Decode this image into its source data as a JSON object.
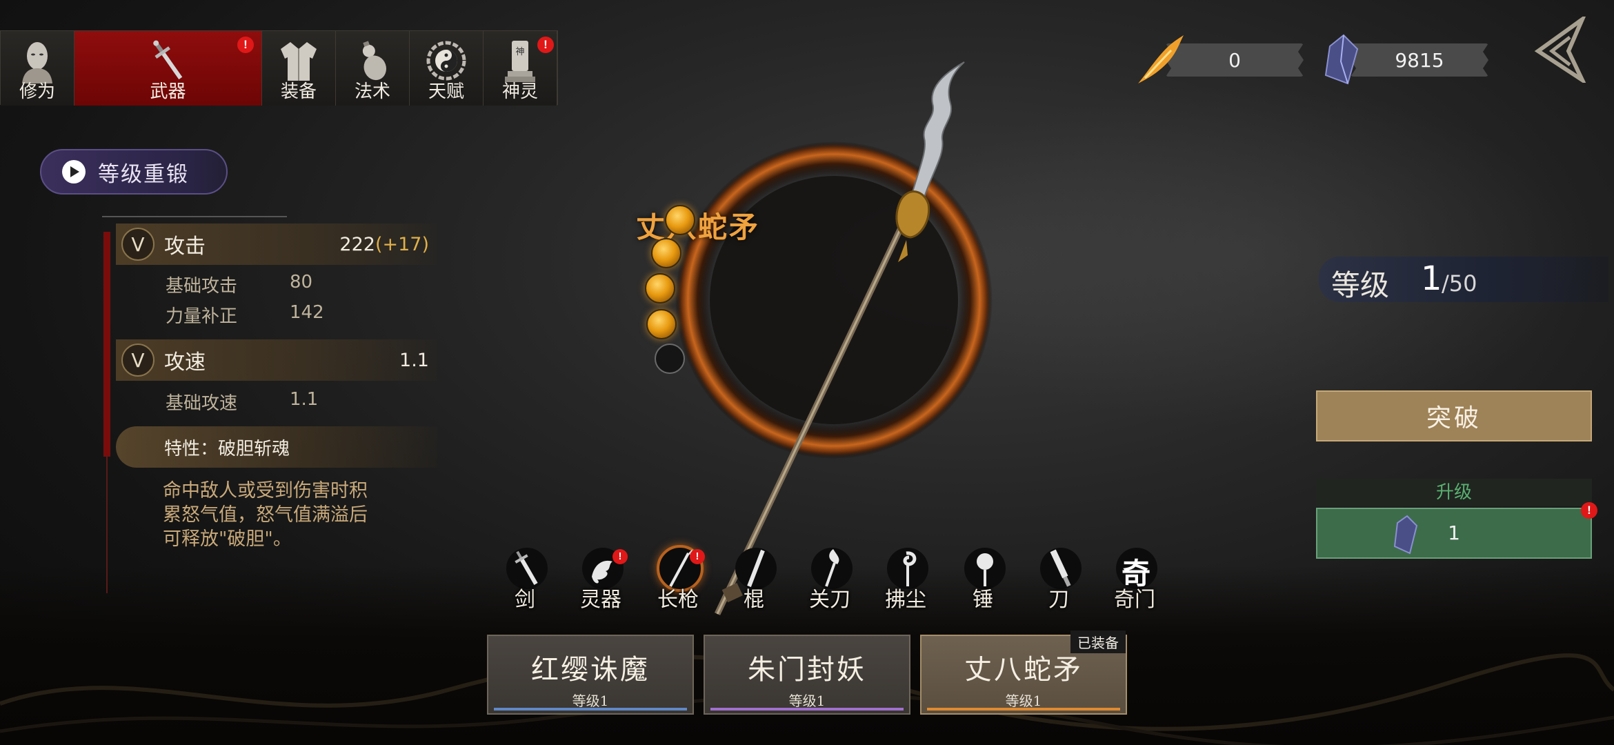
{
  "tabs": [
    {
      "label": "修为",
      "icon": "face-mask-icon",
      "active": false,
      "badge": ""
    },
    {
      "label": "武器",
      "icon": "sword-icon",
      "active": true,
      "badge": "!"
    },
    {
      "label": "装备",
      "icon": "robe-icon",
      "active": false,
      "badge": ""
    },
    {
      "label": "法术",
      "icon": "gourd-icon",
      "active": false,
      "badge": ""
    },
    {
      "label": "天赋",
      "icon": "yin-yang-icon",
      "active": false,
      "badge": ""
    },
    {
      "label": "神灵",
      "icon": "shrine-tablet-icon",
      "active": false,
      "badge": "!"
    }
  ],
  "tab_tablet_glyph": "神",
  "reforge": {
    "label": "等级重锻"
  },
  "stats": {
    "attack": {
      "name": "攻击",
      "value": "222",
      "bonus": "(+17)"
    },
    "attack_subs": [
      {
        "name": "基础攻击",
        "value": "80"
      },
      {
        "name": "力量补正",
        "value": "142"
      }
    ],
    "speed": {
      "name": "攻速",
      "value": "1.1"
    },
    "speed_subs": [
      {
        "name": "基础攻速",
        "value": "1.1"
      }
    ],
    "trait": {
      "name": "特性：破胆斩魂"
    },
    "description": "命中敌人或受到伤害时积累怒气值，怒气值满溢后可释放\"破胆\"。"
  },
  "weapon": {
    "name": "丈八蛇矛",
    "filled_orbs": 4,
    "total_orbs": 5
  },
  "currency": [
    {
      "icon": "flame-feather-icon",
      "amount": "0"
    },
    {
      "icon": "crystal-icon",
      "amount": "9815"
    }
  ],
  "level": {
    "label": "等级",
    "current": "1",
    "max": "/50"
  },
  "break_button": {
    "label": "突破"
  },
  "upgrade": {
    "label": "升级",
    "cost": "1",
    "cost_icon": "crystal-icon",
    "badge": "!"
  },
  "weapon_types": [
    {
      "label": "剑",
      "icon": "sword-icon",
      "badge": ""
    },
    {
      "label": "灵器",
      "icon": "dragon-icon",
      "badge": "!"
    },
    {
      "label": "长枪",
      "icon": "spear-icon",
      "badge": "!",
      "active": true
    },
    {
      "label": "棍",
      "icon": "staff-icon",
      "badge": ""
    },
    {
      "label": "关刀",
      "icon": "guandao-icon",
      "badge": ""
    },
    {
      "label": "拂尘",
      "icon": "whisk-icon",
      "badge": ""
    },
    {
      "label": "锤",
      "icon": "hammer-icon",
      "badge": ""
    },
    {
      "label": "刀",
      "icon": "blade-icon",
      "badge": ""
    },
    {
      "label": "奇门",
      "icon": "qi-glyph-icon",
      "badge": "",
      "glyph": "奇"
    }
  ],
  "weapon_cards": [
    {
      "name": "红缨诛魔",
      "level": "等级1",
      "color": "#5f88c8"
    },
    {
      "name": "朱门封妖",
      "level": "等级1",
      "color": "#a070d0"
    },
    {
      "name": "丈八蛇矛",
      "level": "等级1",
      "color": "#e08a30",
      "tag": "已装备"
    }
  ]
}
